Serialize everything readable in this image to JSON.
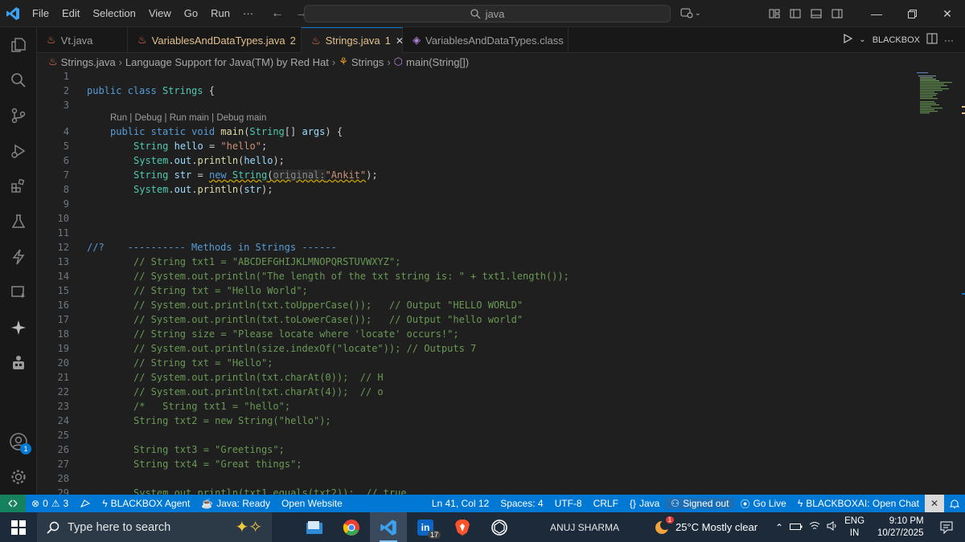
{
  "menu": [
    "File",
    "Edit",
    "Selection",
    "View",
    "Go",
    "Run",
    "···"
  ],
  "search": {
    "text": "java"
  },
  "tabs": [
    {
      "label": "Vt.java",
      "modified": "",
      "active": false
    },
    {
      "label": "VariablesAndDataTypes.java",
      "modified": "2",
      "active": false
    },
    {
      "label": "Strings.java",
      "modified": "1",
      "active": true
    },
    {
      "label": "VariablesAndDataTypes.class",
      "modified": "",
      "active": false
    }
  ],
  "tab_actions": {
    "blackbox": "BLACKBOX"
  },
  "breadcrumb": {
    "file": "Strings.java",
    "part1": "Language Support for Java(TM) by Red Hat",
    "part2": "Strings",
    "part3": "main(String[])"
  },
  "codelens": "Run | Debug | Run main | Debug main",
  "line_numbers": [
    "1",
    "2",
    "3",
    "4",
    "5",
    "6",
    "7",
    "8",
    "9",
    "10",
    "11",
    "12",
    "13",
    "14",
    "15",
    "16",
    "17",
    "18",
    "19",
    "20",
    "21",
    "22",
    "23",
    "24",
    "25",
    "26",
    "27",
    "28",
    "29"
  ],
  "code": {
    "l2": {
      "kw": "public class",
      "name": "Strings",
      "rest": " {"
    },
    "l4": {
      "kw": "public static void",
      "fn": "main",
      "open": "(",
      "type": "String",
      "arr": "[]",
      "arg": "args",
      "rest": ") {"
    },
    "l5": {
      "type": "String",
      "var": "hello",
      "eq": " = ",
      "str": "\"hello\"",
      "end": ";"
    },
    "l6": {
      "obj": "System",
      "dot1": ".",
      "field": "out",
      "dot2": ".",
      "fn": "println",
      "open": "(",
      "arg": "hello",
      "end": ");"
    },
    "l7": {
      "type": "String",
      "var": "str",
      "eq": " = ",
      "kw": "new",
      "ctor": "String",
      "open": "(",
      "hint": "original:",
      "str": "\"Ankit\"",
      "end": ");"
    },
    "l8": {
      "obj": "System",
      "dot1": ".",
      "field": "out",
      "dot2": ".",
      "fn": "println",
      "open": "(",
      "arg": "str",
      "end": ");"
    },
    "l12": {
      "c1": "//?",
      "c2": "    ---------- Methods in Strings ------"
    },
    "l13": "// String txt1 = \"ABCDEFGHIJKLMNOPQRSTUVWXYZ\";",
    "l14": "// System.out.println(\"The length of the txt string is: \" + txt1.length());",
    "l15": "// String txt = \"Hello World\";",
    "l16": "// System.out.println(txt.toUpperCase());   // Output \"HELLO WORLD\"",
    "l17": "// System.out.println(txt.toLowerCase());   // Output \"hello world\"",
    "l18": "// String size = \"Please locate where 'locate' occurs!\";",
    "l19": "// System.out.println(size.indexOf(\"locate\")); // Outputs 7",
    "l20": "// String txt = \"Hello\";",
    "l21": "// System.out.println(txt.charAt(0));  // H",
    "l22": "// System.out.println(txt.charAt(4));  // o",
    "l23": "/*   String txt1 = \"hello\";",
    "l24": "String txt2 = new String(\"hello\");",
    "l26": "String txt3 = \"Greetings\";",
    "l27": "String txt4 = \"Great things\";",
    "l29": "System.out.println(txt1.equals(txt2));  // true"
  },
  "status": {
    "errors": "0",
    "warnings": "3",
    "agent": "BLACKBOX Agent",
    "java_ready": "Java: Ready",
    "open_website": "Open Website",
    "position": "Ln 41, Col 12",
    "spaces": "Spaces: 4",
    "encoding": "UTF-8",
    "eol": "CRLF",
    "language": "Java",
    "signed": "Signed out",
    "golive": "Go Live",
    "chat": "BLACKBOXAI: Open Chat"
  },
  "taskbar": {
    "search": "Type here to search",
    "linkedin_badge": "17",
    "brave_badge": "1",
    "user": "ANUJ SHARMA",
    "weather": "25°C  Mostly clear",
    "lang1": "ENG",
    "lang2": "IN",
    "time": "9:10 PM",
    "date": "10/27/2025"
  },
  "activity_badge": "1",
  "colors": {
    "accent": "#0078d4",
    "statusbar": "#0078d4",
    "remote": "#16825d",
    "modified_tab": "#e2c08d"
  }
}
